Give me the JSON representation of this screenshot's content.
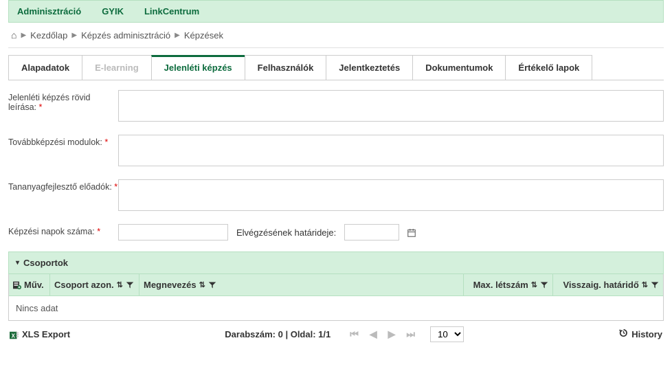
{
  "topnav": {
    "admin": "Adminisztráció",
    "faq": "GYIK",
    "linkcentrum": "LinkCentrum"
  },
  "breadcrumb": {
    "home": "Kezdőlap",
    "level1": "Képzés adminisztráció",
    "level2": "Képzések"
  },
  "tabs": {
    "t0": "Alapadatok",
    "t1": "E-learning",
    "t2": "Jelenléti képzés",
    "t3": "Felhasználók",
    "t4": "Jelentkeztetés",
    "t5": "Dokumentumok",
    "t6": "Értékelő lapok"
  },
  "form": {
    "desc_label": "Jelenléti képzés rövid leírása:",
    "desc_value": "",
    "modules_label": "Továbbképzési modulok:",
    "modules_value": "",
    "lecturers_label": "Tananyagfejlesztő előadók:",
    "lecturers_value": "",
    "days_label": "Képzési napok száma:",
    "days_value": "",
    "deadline_label": "Elvégzésének határideje:",
    "deadline_value": ""
  },
  "panel": {
    "title": "Csoportok"
  },
  "table": {
    "col_muv": "Műv.",
    "col_azon": "Csoport azon.",
    "col_megnev": "Megnevezés",
    "col_max": "Max. létszám",
    "col_hat": "Visszaig. határidő",
    "empty": "Nincs adat"
  },
  "footer": {
    "xls": "XLS Export",
    "count_label": "Darabszám: 0",
    "page_label": "Oldal: 1/1",
    "page_size": "10",
    "history": "History"
  }
}
